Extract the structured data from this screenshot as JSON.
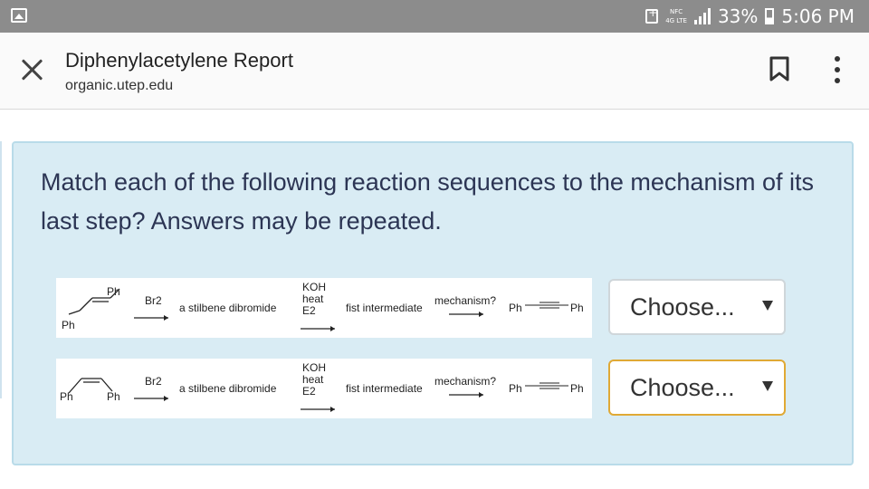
{
  "status_bar": {
    "nfc_label": "NFC",
    "lte_label": "4G LTE",
    "battery": "33%",
    "time": "5:06 PM"
  },
  "app_bar": {
    "title": "Diphenylacetylene Report",
    "domain": "organic.utep.edu"
  },
  "question": {
    "text": "Match each of the following reaction sequences to the mechanism of its last step?  Answers may be repeated."
  },
  "reactions": [
    {
      "substituent_top": "Ph",
      "substituent_bottom_left": "Ph",
      "reagent1": "Br2",
      "intermediate1": "a stilbene dibromide",
      "reagent2_lines": [
        "KOH",
        "heat",
        "E2"
      ],
      "intermediate2": "fist intermediate",
      "reagent3": "mechanism?",
      "product_left": "Ph",
      "product_right": "Ph",
      "select_value": "Choose..."
    },
    {
      "substituent_top": "",
      "substituent_bottom_left": "Ph",
      "substituent_bottom_right": "Ph",
      "reagent1": "Br2",
      "intermediate1": "a stilbene dibromide",
      "reagent2_lines": [
        "KOH",
        "heat",
        "E2"
      ],
      "intermediate2": "fist intermediate",
      "reagent3": "mechanism?",
      "product_left": "Ph",
      "product_right": "Ph",
      "select_value": "Choose..."
    }
  ],
  "colors": {
    "status_bar": "#8c8c8c",
    "card_bg": "#d9ecf4",
    "card_border": "#b9dbe9",
    "question_text": "#2c3554",
    "focused_select_border": "#e0a935"
  }
}
